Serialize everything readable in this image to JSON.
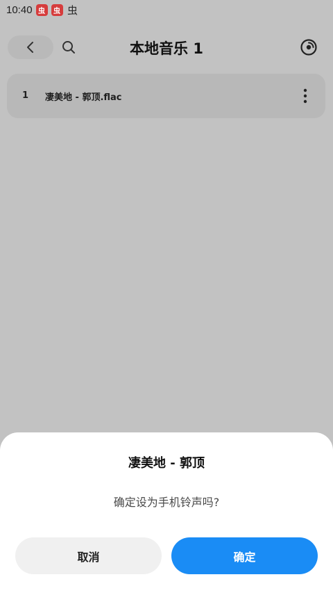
{
  "status_bar": {
    "time": "10:40",
    "app_icons": [
      "虫",
      "虫",
      "虫"
    ]
  },
  "header": {
    "title": "本地音乐 1",
    "back_icon": "chevron-left-icon",
    "search_icon": "search-icon",
    "disc_icon": "disc-icon"
  },
  "songs": [
    {
      "index": "1",
      "title": "凄美地 - 郭顶.flac"
    }
  ],
  "dialog": {
    "title": "凄美地 - 郭顶",
    "message": "确定设为手机铃声吗?",
    "cancel_label": "取消",
    "confirm_label": "确定"
  },
  "colors": {
    "overlay_background": "#c2c2c2",
    "confirm_button": "#1a8cf5",
    "cancel_button": "#f0f0f0"
  }
}
